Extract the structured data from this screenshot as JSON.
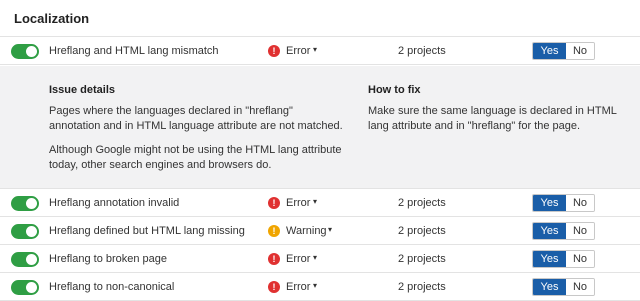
{
  "section": {
    "title": "Localization"
  },
  "rows": [
    {
      "name": "Hreflang and HTML lang mismatch",
      "severity": "Error",
      "severity_icon": "!",
      "count": "2 projects",
      "yes": "Yes",
      "no": "No"
    },
    {
      "name": "Hreflang annotation invalid",
      "severity": "Error",
      "severity_icon": "!",
      "count": "2 projects",
      "yes": "Yes",
      "no": "No"
    },
    {
      "name": "Hreflang defined but HTML lang missing",
      "severity": "Warning",
      "severity_icon": "!",
      "count": "2 projects",
      "yes": "Yes",
      "no": "No"
    },
    {
      "name": "Hreflang to broken page",
      "severity": "Error",
      "severity_icon": "!",
      "count": "2 projects",
      "yes": "Yes",
      "no": "No"
    },
    {
      "name": "Hreflang to non-canonical",
      "severity": "Error",
      "severity_icon": "!",
      "count": "2 projects",
      "yes": "Yes",
      "no": "No"
    }
  ],
  "details": {
    "issue_heading": "Issue details",
    "issue_text_1": "Pages where the languages declared in \"hreflang\" annotation and in HTML language attribute are not matched.",
    "issue_text_2": "Although Google might not be using the HTML lang attribute today, other search engines and browsers do.",
    "fix_heading": "How to fix",
    "fix_text": "Make sure the same language is declared in HTML lang attribute and in \"hreflang\" for the page."
  },
  "caret": "▾",
  "colors": {
    "toggle_on": "#2f9e44",
    "error": "#e03131",
    "warning": "#f0a500",
    "yes_active": "#1a5ea8"
  }
}
